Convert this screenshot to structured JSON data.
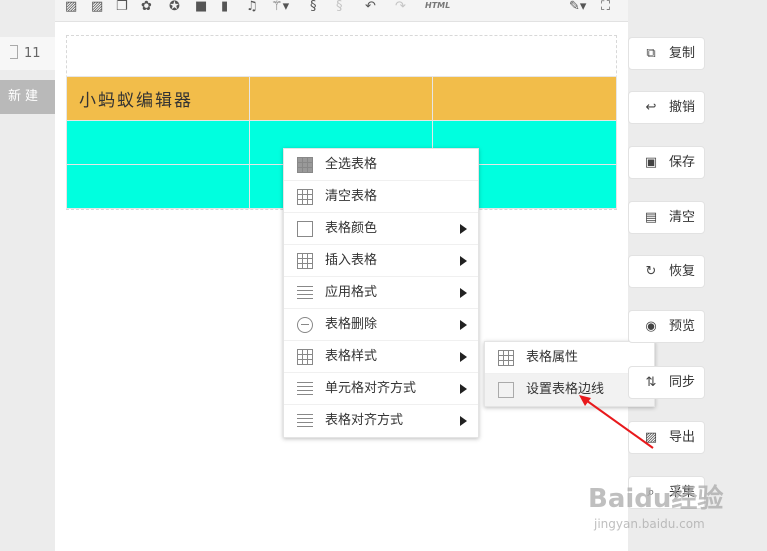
{
  "left": {
    "count": "11",
    "new_label": "新建"
  },
  "toolbar": {
    "html_label": "HTML"
  },
  "table": {
    "rows": [
      [
        "小蚂蚁编辑器",
        "",
        ""
      ],
      [
        "",
        "",
        ""
      ],
      [
        "",
        "",
        ""
      ]
    ],
    "row_colors": [
      "#f2bd4a",
      "#00ffdf",
      "#00ffdf"
    ]
  },
  "context_menu": {
    "items": [
      {
        "label": "全选表格",
        "icon": "table-select-icon",
        "has_submenu": false
      },
      {
        "label": "清空表格",
        "icon": "table-clear-icon",
        "has_submenu": false
      },
      {
        "label": "表格颜色",
        "icon": "paint-bucket-icon",
        "has_submenu": true
      },
      {
        "label": "插入表格",
        "icon": "table-insert-icon",
        "has_submenu": true
      },
      {
        "label": "应用格式",
        "icon": "format-list-icon",
        "has_submenu": true
      },
      {
        "label": "表格删除",
        "icon": "minus-circle-icon",
        "has_submenu": true
      },
      {
        "label": "表格样式",
        "icon": "table-style-icon",
        "has_submenu": true
      },
      {
        "label": "单元格对齐方式",
        "icon": "cell-align-icon",
        "has_submenu": true
      },
      {
        "label": "表格对齐方式",
        "icon": "table-align-icon",
        "has_submenu": true
      }
    ]
  },
  "submenu": {
    "items": [
      {
        "label": "表格属性",
        "icon": "table-properties-icon"
      },
      {
        "label": "设置表格边线",
        "icon": "gear-icon"
      }
    ]
  },
  "actions": [
    {
      "label": "复制",
      "icon": "copy-icon"
    },
    {
      "label": "撤销",
      "icon": "undo-icon"
    },
    {
      "label": "保存",
      "icon": "save-icon"
    },
    {
      "label": "清空",
      "icon": "trash-icon"
    },
    {
      "label": "恢复",
      "icon": "restore-icon"
    },
    {
      "label": "预览",
      "icon": "eye-icon"
    },
    {
      "label": "同步",
      "icon": "sync-icon"
    },
    {
      "label": "导出",
      "icon": "export-icon"
    },
    {
      "label": "采集",
      "icon": "search-icon"
    }
  ],
  "watermark": {
    "brand": "Baidu经验",
    "url": "jingyan.baidu.com"
  }
}
